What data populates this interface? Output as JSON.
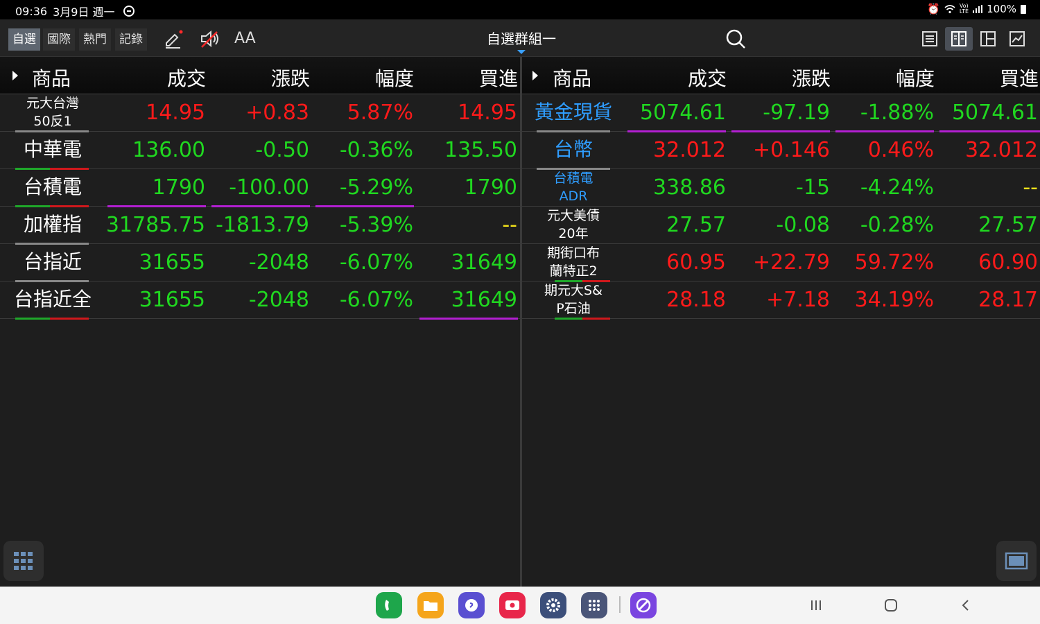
{
  "status_bar": {
    "time": "09:36",
    "date": "3月9日 週一",
    "battery": "100%",
    "icons": [
      "dnd-icon",
      "alarm-icon",
      "wifi-icon",
      "volte-icon",
      "signal-icon",
      "battery-icon"
    ]
  },
  "toolbar": {
    "tabs": [
      "自選",
      "國際",
      "熱門",
      "記錄"
    ],
    "active_tab": "自選",
    "group_title": "自選群組一",
    "icons": [
      "edit-icon",
      "mute-icon",
      "font-size-icon",
      "search-icon",
      "list-view-icon",
      "split-view-icon",
      "quad-view-icon",
      "chart-view-icon"
    ],
    "font_label": "AA"
  },
  "left_panel": {
    "headers": [
      "商品",
      "成交",
      "漲跌",
      "幅度",
      "買進"
    ],
    "rows": [
      {
        "name": "元大台灣\n50反1",
        "price": "14.95",
        "change": "+0.83",
        "pct": "5.87%",
        "bid": "14.95"
      },
      {
        "name": "中華電",
        "price": "136.00",
        "change": "-0.50",
        "pct": "-0.36%",
        "bid": "135.50"
      },
      {
        "name": "台積電",
        "price": "1790",
        "change": "-100.00",
        "pct": "-5.29%",
        "bid": "1790"
      },
      {
        "name": "加權指",
        "price": "31785.75",
        "change": "-1813.79",
        "pct": "-5.39%",
        "bid": "--"
      },
      {
        "name": "台指近",
        "price": "31655",
        "change": "-2048",
        "pct": "-6.07%",
        "bid": "31649"
      },
      {
        "name": "台指近全",
        "price": "31655",
        "change": "-2048",
        "pct": "-6.07%",
        "bid": "31649"
      }
    ]
  },
  "right_panel": {
    "headers": [
      "商品",
      "成交",
      "漲跌",
      "幅度",
      "買進"
    ],
    "rows": [
      {
        "name": "黃金現貨",
        "price": "5074.61",
        "change": "-97.19",
        "pct": "-1.88%",
        "bid": "5074.61"
      },
      {
        "name": "台幣",
        "price": "32.012",
        "change": "+0.146",
        "pct": "0.46%",
        "bid": "32.012"
      },
      {
        "name": "台積電\nADR",
        "price": "338.86",
        "change": "-15",
        "pct": "-4.24%",
        "bid": "--"
      },
      {
        "name": "元大美債\n20年",
        "price": "27.57",
        "change": "-0.08",
        "pct": "-0.28%",
        "bid": "27.57"
      },
      {
        "name": "期街口布\n蘭特正2",
        "price": "60.95",
        "change": "+22.79",
        "pct": "59.72%",
        "bid": "60.90"
      },
      {
        "name": "期元大S&\nP石油",
        "price": "28.18",
        "change": "+7.18",
        "pct": "34.19%",
        "bid": "28.17"
      }
    ]
  },
  "colors": {
    "up": "#ff1a1a",
    "down": "#20d820",
    "highlight": "#b21fd1",
    "blue": "#2f9dff"
  },
  "dock_apps": [
    "phone-icon",
    "files-icon",
    "messages-icon",
    "screen-recorder-icon",
    "settings-icon",
    "app-drawer-icon",
    "internet-icon"
  ],
  "nav_keys": [
    "recents-icon",
    "home-icon",
    "back-icon"
  ]
}
